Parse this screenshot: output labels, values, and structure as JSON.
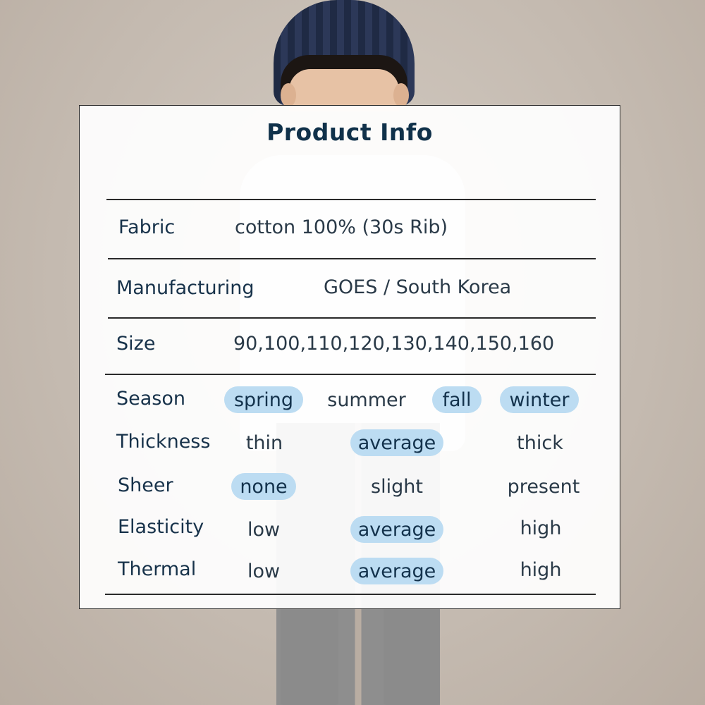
{
  "panel": {
    "title": "Product Info",
    "rows": {
      "fabric": {
        "label": "Fabric",
        "value": "cotton 100% (30s Rib)"
      },
      "manufacturing": {
        "label": "Manufacturing",
        "value": "GOES / South Korea"
      },
      "size": {
        "label": "Size",
        "value": "90,100,110,120,130,140,150,160"
      }
    },
    "attributes": {
      "season": {
        "label": "Season",
        "options": [
          "spring",
          "summer",
          "fall",
          "winter"
        ],
        "selected": [
          "spring",
          "fall",
          "winter"
        ]
      },
      "thickness": {
        "label": "Thickness",
        "options": [
          "thin",
          "average",
          "thick"
        ],
        "selected": [
          "average"
        ]
      },
      "sheer": {
        "label": "Sheer",
        "options": [
          "none",
          "slight",
          "present"
        ],
        "selected": [
          "none"
        ]
      },
      "elasticity": {
        "label": "Elasticity",
        "options": [
          "low",
          "average",
          "high"
        ],
        "selected": [
          "average"
        ]
      },
      "thermal": {
        "label": "Thermal",
        "options": [
          "low",
          "average",
          "high"
        ],
        "selected": [
          "average"
        ]
      }
    }
  },
  "colors": {
    "highlight": "#bcdcf2",
    "title": "#10314a",
    "panel_border": "#2a2a2a"
  }
}
